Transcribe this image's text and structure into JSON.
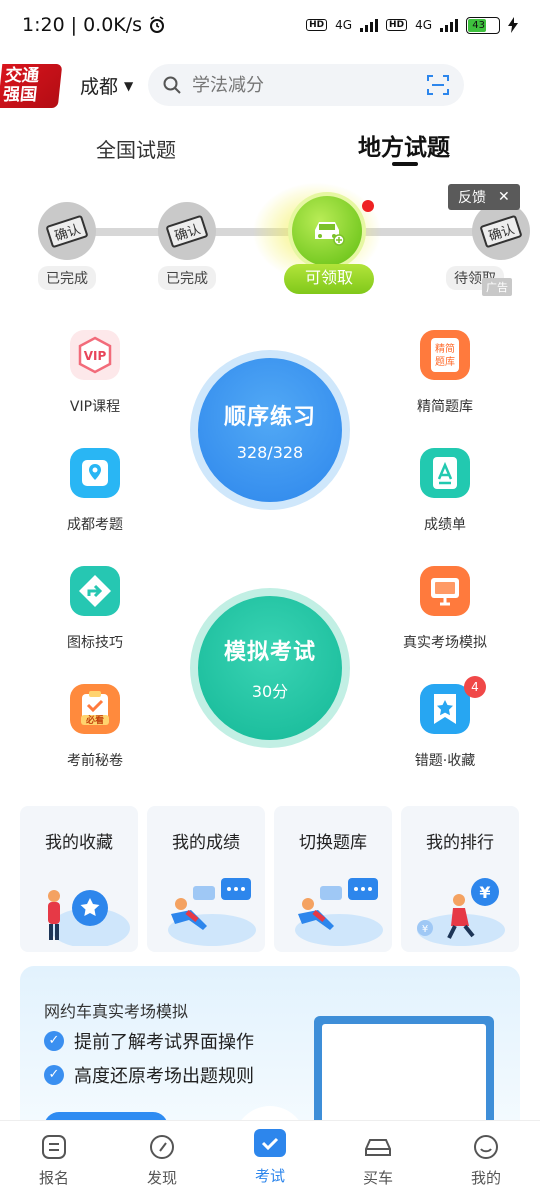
{
  "status_bar": {
    "time": "1:20",
    "speed": "0.0K/s",
    "network1": "4G",
    "network2": "4G",
    "battery": "43"
  },
  "header": {
    "logo_text_line1": "交通",
    "logo_text_line2": "强国",
    "city": "成都",
    "search_placeholder": "学法减分"
  },
  "tabs": [
    {
      "label": "全国试题",
      "active": false
    },
    {
      "label": "地方试题",
      "active": true
    }
  ],
  "progress": {
    "nodes": [
      {
        "stamp": "确认",
        "label": "已完成"
      },
      {
        "stamp": "确认",
        "label": "已完成"
      },
      {
        "stamp": "确认",
        "label": "待领取"
      }
    ],
    "claim_button": "可领取",
    "feedback_label": "反馈",
    "ad_label": "广告"
  },
  "features": {
    "vip": "VIP课程",
    "vip_icon_text": "VIP",
    "simplified": "精简题库",
    "simplified_icon_text1": "精简",
    "simplified_icon_text2": "题库",
    "chengdu": "成都考题",
    "score": "成绩单",
    "sign_tips": "图标技巧",
    "real_exam": "真实考场模拟",
    "secret": "考前秘卷",
    "secret_icon_text": "必看",
    "wrong_fav": "错题·收藏",
    "wrong_badge": "4"
  },
  "practice": {
    "title": "顺序练习",
    "progress": "328/328"
  },
  "mock": {
    "title": "模拟考试",
    "score": "30分"
  },
  "quick_cards": [
    "我的收藏",
    "我的成绩",
    "切换题库",
    "我的排行"
  ],
  "promo": {
    "title": "网约车真实考场模拟",
    "points": [
      "提前了解考试界面操作",
      "高度还原考场出题规则"
    ]
  },
  "nav": [
    {
      "label": "报名",
      "icon": "form-icon"
    },
    {
      "label": "发现",
      "icon": "compass-icon"
    },
    {
      "label": "考试",
      "icon": "exam-check-icon"
    },
    {
      "label": "买车",
      "icon": "car-icon"
    },
    {
      "label": "我的",
      "icon": "smile-icon"
    }
  ],
  "colors": {
    "accent_blue": "#2d86ec",
    "accent_green": "#14b897",
    "claim_green": "#80c81a",
    "badge_red": "#f04848"
  }
}
